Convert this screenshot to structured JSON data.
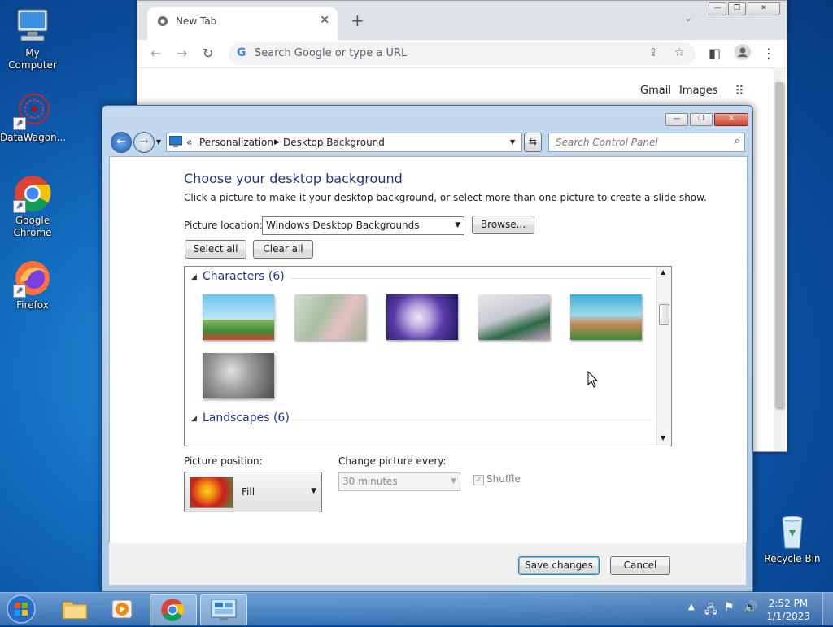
{
  "desktop": {
    "icons": [
      {
        "label": "My Computer"
      },
      {
        "label": "DataWagon..."
      },
      {
        "label": "Google Chrome"
      },
      {
        "label": "Firefox"
      },
      {
        "label": "Recycle Bin"
      }
    ]
  },
  "chrome": {
    "tab_title": "New Tab",
    "omnibox_placeholder": "Search Google or type a URL",
    "links": {
      "gmail": "Gmail",
      "images": "Images"
    }
  },
  "control_panel": {
    "breadcrumb": [
      "Personalization",
      "Desktop Background"
    ],
    "search_placeholder": "Search Control Panel",
    "heading": "Choose your desktop background",
    "instruction": "Click a picture to make it your desktop background, or select more than one picture to create a slide show.",
    "picture_location_label": "Picture location:",
    "picture_location_value": "Windows Desktop Backgrounds",
    "browse_label": "Browse...",
    "select_all_label": "Select all",
    "clear_all_label": "Clear all",
    "groups": [
      {
        "title": "Characters (6)",
        "thumbnail_count": 6
      },
      {
        "title": "Landscapes (6)"
      }
    ],
    "picture_position_label": "Picture position:",
    "picture_position_value": "Fill",
    "change_picture_label": "Change picture every:",
    "change_picture_value": "30 minutes",
    "shuffle_label": "Shuffle",
    "shuffle_checked": true,
    "save_label": "Save changes",
    "cancel_label": "Cancel"
  },
  "taskbar": {
    "time": "2:52 PM",
    "date": "1/1/2023"
  },
  "colors": {
    "heading": "#1e3287",
    "desktop_blue": "#1570c4",
    "chrome_tabstrip": "#dee1e6"
  }
}
